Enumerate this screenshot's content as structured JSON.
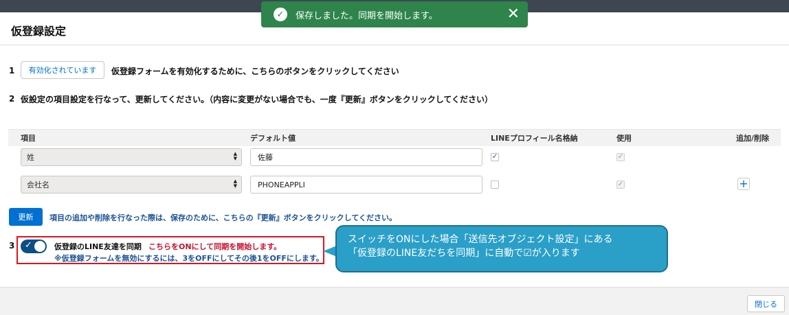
{
  "toast": {
    "message": "保存しました。同期を開始します。",
    "check_glyph": "✓",
    "close_glyph": "✕"
  },
  "header": {
    "title": "仮登録設定"
  },
  "step1": {
    "num": "1",
    "button_label": "有効化されています",
    "instruction": "仮登録フォームを有効化するために、こちらのボタンをクリックしてください"
  },
  "step2": {
    "num": "2",
    "instruction": "仮設定の項目設定を行なって、更新してください。（内容に変更がない場合でも、一度『更新』ボタンをクリックしてください）"
  },
  "table": {
    "headers": {
      "item": "項目",
      "default_value": "デフォルト値",
      "line_profile": "LINEプロフィール名格納",
      "use": "使用",
      "add_remove": "追加/削除"
    },
    "rows": [
      {
        "item": "姓",
        "default_value": "佐藤",
        "line_profile": true,
        "use": true
      },
      {
        "item": "会社名",
        "default_value": "PHONEAPPLI",
        "line_profile": false,
        "use": true
      }
    ],
    "add_glyph": "+"
  },
  "update": {
    "button_label": "更新",
    "note": "項目の追加や削除を行なった際は、保存のために、こちらの『更新』ボタンをクリックしてください。"
  },
  "step3": {
    "num": "3",
    "toggle_on": true,
    "label": "仮登録のLINE友達を同期",
    "red_note": "こちらをONにして同期を開始します。",
    "blue_note": "※仮登録フォームを無効にするには、3をOFFにしてその後1をOFFにします。"
  },
  "callout": {
    "line1": "スイッチをONにした場合「送信先オブジェクト設定」にある",
    "line2": "「仮登録のLINE友だちを同期」に自動で☑が入ります"
  },
  "footer": {
    "close_label": "閉じる"
  },
  "colors": {
    "toast": "#2e844a",
    "brand": "#0070d2",
    "highlight_border": "#e0131b",
    "callout": "#2a9fc8"
  }
}
